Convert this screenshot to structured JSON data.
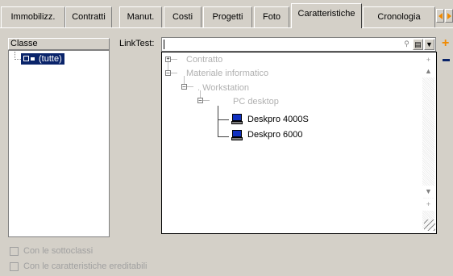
{
  "tabs": [
    {
      "label": "Immobilizz.",
      "active": false
    },
    {
      "label": "Contratti",
      "active": false
    },
    {
      "label": "Manut.",
      "active": false
    },
    {
      "label": "Costi",
      "active": false
    },
    {
      "label": "Progetti",
      "active": false
    },
    {
      "label": "Foto",
      "active": false
    },
    {
      "label": "Caratteristiche",
      "active": true
    },
    {
      "label": "Cronologia",
      "active": false
    }
  ],
  "classe_panel": {
    "header": "Classe",
    "root_item": "(tutte)"
  },
  "linktest": {
    "label": "LinkTest:",
    "value": ""
  },
  "tree": {
    "nodes": [
      {
        "label": "Contratto",
        "state": "collapsed",
        "faint": true
      },
      {
        "label": "Materiale informatico",
        "state": "expanded",
        "faint": true
      },
      {
        "label": ". Workstation",
        "state": "expanded",
        "faint": true
      },
      {
        "label": "PC desktop",
        "state": "expanded",
        "faint": true
      },
      {
        "label": "Deskpro 4000S",
        "faint": false
      },
      {
        "label": "Deskpro 6000",
        "faint": false
      }
    ]
  },
  "options": {
    "with_subclasses": {
      "label": "Con le sottoclassi",
      "checked": false,
      "enabled": false
    },
    "with_inheritable": {
      "label": "Con le caratteristiche ereditabili",
      "checked": false,
      "enabled": false
    }
  },
  "colors": {
    "background": "#d4d0c8",
    "selection": "#0a246a",
    "accent": "#f08a00",
    "disabled_text": "#a0a0a0"
  },
  "icons": {
    "scroll_left": "arrow-left-icon",
    "scroll_right": "arrow-right-icon",
    "search": "magnifier-icon",
    "list": "list-icon",
    "dropdown": "chevron-down-icon",
    "add": "plus-icon",
    "remove": "minus-icon",
    "computer": "desktop-computer-icon"
  }
}
